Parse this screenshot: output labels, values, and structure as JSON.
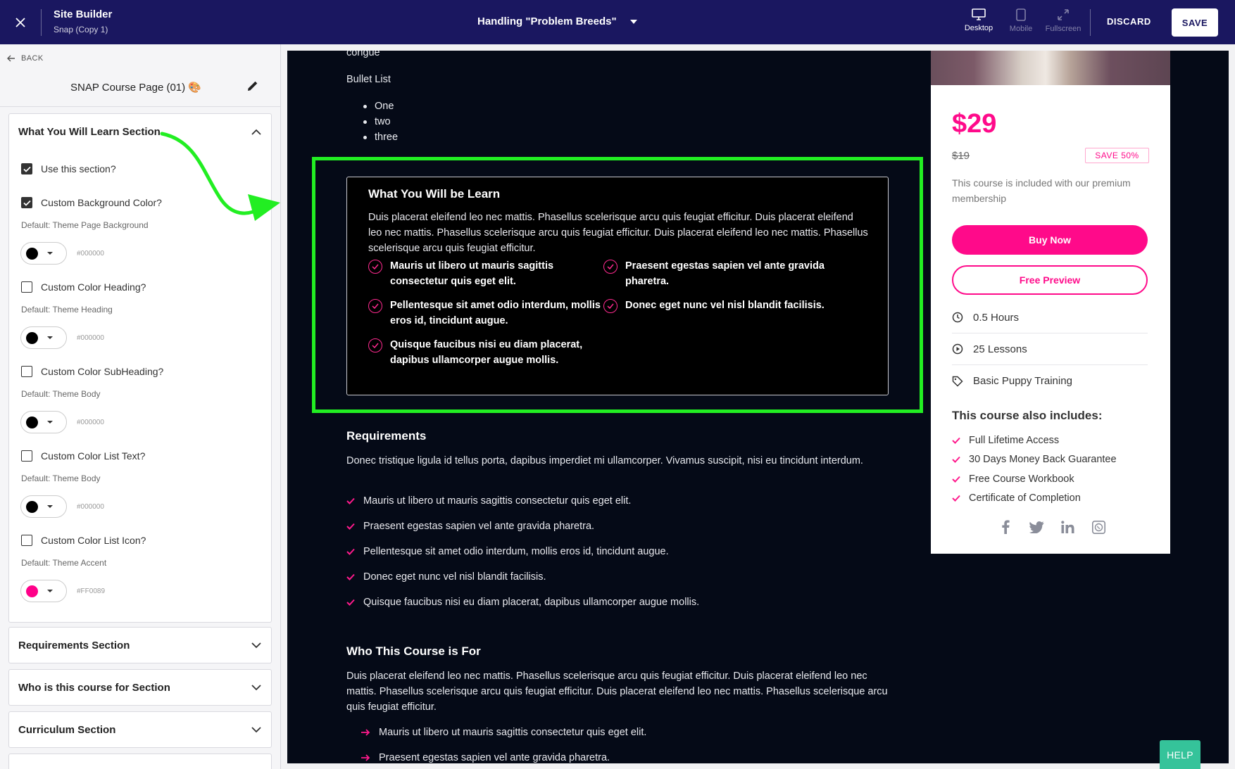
{
  "topbar": {
    "title": "Site Builder",
    "subtitle": "Snap (Copy 1)",
    "page_name": "Handling \"Problem Breeds\"",
    "views": [
      {
        "label": "Desktop",
        "icon": "desktop-icon",
        "active": true
      },
      {
        "label": "Mobile",
        "icon": "mobile-icon",
        "active": false
      },
      {
        "label": "Fullscreen",
        "icon": "fullscreen-icon",
        "active": false
      }
    ],
    "discard_label": "DISCARD",
    "save_label": "SAVE"
  },
  "sidebar": {
    "back_label": "BACK",
    "page_title": "SNAP Course Page (01) 🎨",
    "open_section": {
      "title": "What You Will Learn Section",
      "options": [
        {
          "label": "Use this section?",
          "checked": true
        },
        {
          "label": "Custom Background Color?",
          "checked": true,
          "default": "Default: Theme Page Background",
          "color": "#000000",
          "color_label": "#000000"
        },
        {
          "label": "Custom Color Heading?",
          "checked": false,
          "default": "Default: Theme Heading",
          "color": "#000000",
          "color_label": "#000000"
        },
        {
          "label": "Custom Color SubHeading?",
          "checked": false,
          "default": "Default: Theme Body",
          "color": "#000000",
          "color_label": "#000000"
        },
        {
          "label": "Custom Color List Text?",
          "checked": false,
          "default": "Default: Theme Body",
          "color": "#000000",
          "color_label": "#000000"
        },
        {
          "label": "Custom Color List Icon?",
          "checked": false,
          "default": "Default: Theme Accent",
          "color": "#FF0089",
          "color_label": "#FF0089"
        }
      ]
    },
    "closed_sections": [
      "Requirements Section",
      "Who is this course for Section",
      "Curriculum Section"
    ]
  },
  "preview": {
    "top_text": "congue",
    "bullet_label": "Bullet List",
    "bullets": [
      "One",
      "two",
      "three"
    ],
    "learn": {
      "title": "What You Will be Learn",
      "description": "Duis placerat eleifend leo nec mattis. Phasellus scelerisque arcu quis feugiat efficitur. Duis placerat eleifend leo nec mattis. Phasellus scelerisque arcu quis feugiat efficitur. Duis placerat eleifend leo nec mattis. Phasellus scelerisque arcu quis feugiat efficitur.",
      "items": [
        "Mauris ut libero ut mauris sagittis consectetur quis eget elit.",
        "Praesent egestas sapien vel ante gravida pharetra.",
        "Pellentesque sit amet odio interdum, mollis eros id, tincidunt augue.",
        "Donec eget nunc vel nisl blandit facilisis.",
        "Quisque faucibus nisi eu diam placerat, dapibus ullamcorper augue mollis."
      ]
    },
    "requirements": {
      "title": "Requirements",
      "description": "Donec tristique ligula id tellus porta, dapibus imperdiet mi ullamcorper. Vivamus suscipit, nisi eu tincidunt interdum.",
      "items": [
        "Mauris ut libero ut mauris sagittis consectetur quis eget elit.",
        "Praesent egestas sapien vel ante gravida pharetra.",
        "Pellentesque sit amet odio interdum, mollis eros id, tincidunt augue.",
        "Donec eget nunc vel nisl blandit facilisis.",
        "Quisque faucibus nisi eu diam placerat, dapibus ullamcorper augue mollis."
      ]
    },
    "who": {
      "title": "Who This Course is For",
      "description": "Duis placerat eleifend leo nec mattis. Phasellus scelerisque arcu quis feugiat efficitur. Duis placerat eleifend leo nec mattis. Phasellus scelerisque arcu quis feugiat efficitur. Duis placerat eleifend leo nec mattis. Phasellus scelerisque arcu quis feugiat efficitur.",
      "items": [
        "Mauris ut libero ut mauris sagittis consectetur quis eget elit.",
        "Praesent egestas sapien vel ante gravida pharetra."
      ]
    },
    "card": {
      "price": "$29",
      "old_price": "$19",
      "save_badge": "SAVE 50%",
      "note": "This course is included with our premium membership",
      "buy_label": "Buy Now",
      "preview_label": "Free Preview",
      "meta": [
        {
          "icon": "clock-icon",
          "text": "0.5 Hours"
        },
        {
          "icon": "play-icon",
          "text": "25 Lessons"
        },
        {
          "icon": "tag-icon",
          "text": "Basic Puppy Training"
        }
      ],
      "includes_title": "This course also includes:",
      "includes": [
        "Full Lifetime Access",
        "30 Days Money Back Guarantee",
        "Free Course Workbook",
        "Certificate of Completion"
      ],
      "socials": [
        "facebook-icon",
        "twitter-icon",
        "linkedin-icon",
        "whatsapp-icon"
      ]
    }
  },
  "help_label": "HELP",
  "colors": {
    "topbar": "#1a1760",
    "accent": "#ff0a8a",
    "highlight": "#22ee22",
    "preview_bg": "#050a17",
    "help": "#35c39a"
  }
}
